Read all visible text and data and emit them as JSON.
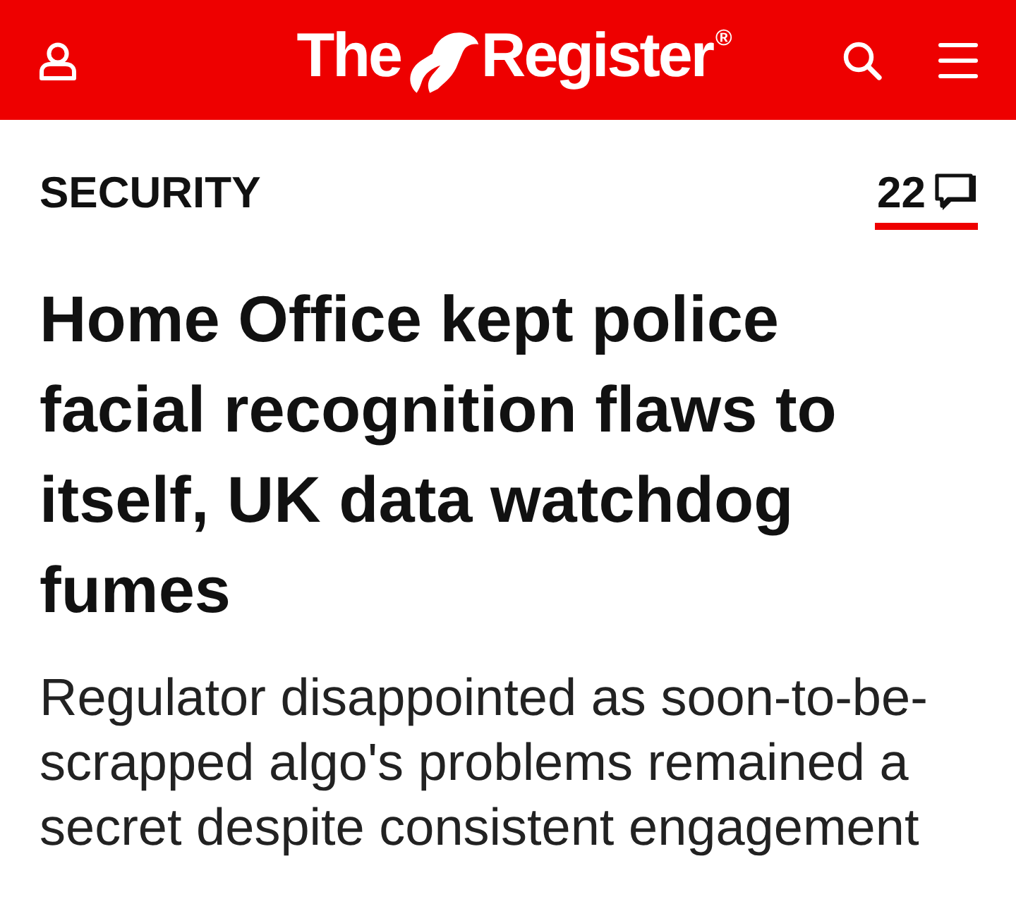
{
  "header": {
    "logo": {
      "before": "The",
      "after": "Register",
      "mark": "®"
    }
  },
  "article": {
    "section": "SECURITY",
    "comment_count": "22",
    "headline": "Home Office kept police facial recognition flaws to itself, UK data watchdog fumes",
    "standfirst": "Regulator disappointed as soon-to-be-scrapped algo's problems remained a secret despite consistent engagement"
  }
}
